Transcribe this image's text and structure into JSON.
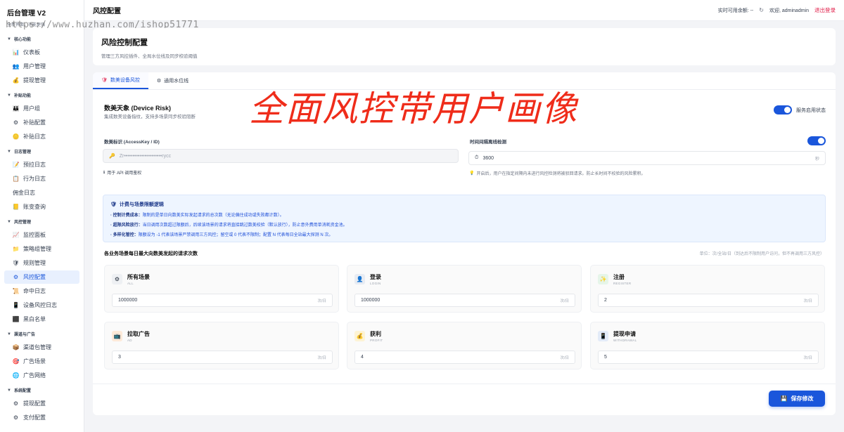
{
  "sidebar": {
    "brand_title": "后台管理 V2",
    "brand_sub": "全新界面，功能更强",
    "groups": [
      {
        "label": "核心功能",
        "items": [
          "仪表板",
          "用户管理",
          "提现管理"
        ]
      },
      {
        "label": "补贴功能",
        "items": [
          "用户组",
          "补贴配置",
          "补贴日志"
        ]
      },
      {
        "label": "日志管理",
        "items": [
          "预拉日志",
          "行为日志",
          "佣金日志",
          "账变查询"
        ]
      },
      {
        "label": "风控管理",
        "items": [
          "监控面板",
          "策略组管理",
          "规则管理",
          "风控配置",
          "命中日志",
          "设备风控日志",
          "黑白名单"
        ]
      },
      {
        "label": "渠道与广告",
        "items": [
          "渠道包管理",
          "广告场景",
          "广告网络"
        ]
      },
      {
        "label": "系统配置",
        "items": [
          "提现配置",
          "支付配置"
        ]
      }
    ]
  },
  "topbar": {
    "title": "风控配置",
    "balance_label": "实时可用余额: --",
    "welcome": "欢迎, adminadmin",
    "logout": "退出登录"
  },
  "header": {
    "title": "风险控制配置",
    "subtitle": "管理三方风控插件、全局水位线及同步校验阈值"
  },
  "tabs": [
    "数美设备风控",
    "通用水位线"
  ],
  "section": {
    "title": "数美天象 (Device Risk)",
    "subtitle": "集成数美设备指纹，支持多场景同步校验阻断",
    "service_toggle_label": "服务启用状态",
    "service_enabled": true
  },
  "watermark_text": "全面风控带用户画像",
  "url_watermark": "https://www.huzhan.com/ishop51771",
  "access_key": {
    "label": "数美标识 (AccessKey / ID)",
    "value": "Zr••••••••••••••••••••••rycc",
    "hint": "用于 API 调用鉴权"
  },
  "interval": {
    "label": "时间间隔离线检测",
    "enabled": true,
    "value": "3600",
    "suffix": "秒",
    "hint": "开启后，用户在指定间隔内未进行风控检测将被驳回请求。防止长时间不校验的风险累积。"
  },
  "notice": {
    "title": "计费与场景限额逻辑",
    "lines": [
      {
        "bold": "· 控制计费成本：",
        "text": "限制的是单日向数美实际发起请求的总次数（无论偏住成功或失败都计数）。"
      },
      {
        "bold": "· 超限风险放行：",
        "text": "当日调用次数超过限额后，后续该场景的请求将直接跳过数美校验（默认放行），防止意外费用单消耗资金池。"
      },
      {
        "bold": "· 多样化管控：",
        "text": "限额设为 -1 代表该场景严禁调用三方风控；留空或 0 代表不限制；配置 N 代表每日全站最大探测 N 次。"
      }
    ]
  },
  "limits": {
    "title": "各业务场景每日最大向数美发起的请求次数",
    "unit_note": "单位：次/全站/日（到达后不限制用户访问，但不再调用三方风控）",
    "scenes": [
      {
        "name": "所有场景",
        "code": "ALL",
        "value": "1000000",
        "suffix": "次/日",
        "icon": "gear-icon",
        "icon_bg": "#eef0f3"
      },
      {
        "name": "登录",
        "code": "LOGIN",
        "value": "1000000",
        "suffix": "次/日",
        "icon": "user-icon",
        "icon_bg": "#e8ecf3"
      },
      {
        "name": "注册",
        "code": "REGISTER",
        "value": "2",
        "suffix": "次/日",
        "icon": "sparkle-icon",
        "icon_bg": "#e6f5e9"
      },
      {
        "name": "拉取广告",
        "code": "AD",
        "value": "3",
        "suffix": "次/日",
        "icon": "ad-icon",
        "icon_bg": "#fde9d8"
      },
      {
        "name": "获利",
        "code": "PROFIT",
        "value": "4",
        "suffix": "次/日",
        "icon": "coin-icon",
        "icon_bg": "#fdf3d4"
      },
      {
        "name": "提现申请",
        "code": "WITHDRAWAL",
        "value": "5",
        "suffix": "次/日",
        "icon": "phone-icon",
        "icon_bg": "#e3ebf8"
      }
    ]
  },
  "save_label": "保存修改",
  "colors": {
    "accent": "#1a56db",
    "danger": "#e11d48",
    "watermark": "#ef2c1a"
  }
}
